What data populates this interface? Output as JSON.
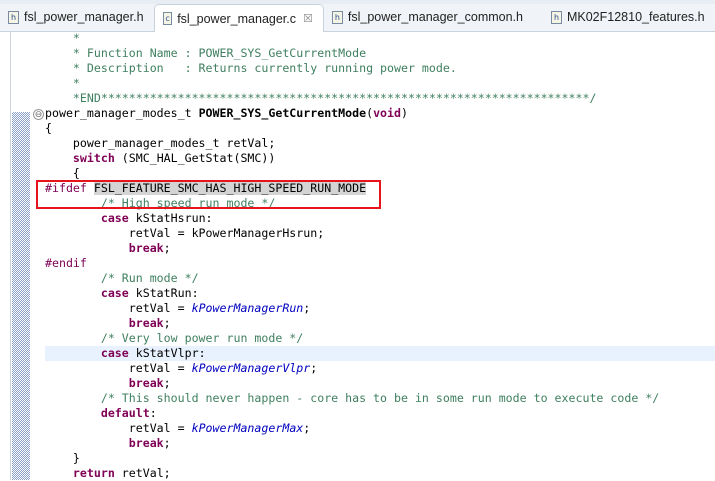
{
  "tabs": [
    {
      "label": "fsl_power_manager.h",
      "icon": "h-file-icon",
      "glyph": "h"
    },
    {
      "label": "fsl_power_manager.c",
      "icon": "c-file-icon",
      "glyph": "c",
      "active": true,
      "close": "☒"
    },
    {
      "label": "fsl_power_manager_common.h",
      "icon": "h-file-icon",
      "glyph": "h"
    },
    {
      "label": "MK02F12810_features.h",
      "icon": "h-file-icon",
      "glyph": "h"
    }
  ],
  "code": [
    [
      [
        "c",
        "    *"
      ]
    ],
    [
      [
        "c",
        "    * Function Name : POWER_SYS_GetCurrentMode"
      ]
    ],
    [
      [
        "c",
        "    * Description   : Returns currently running power mode."
      ]
    ],
    [
      [
        "c",
        "    *"
      ]
    ],
    [
      [
        "c",
        "    *END**********************************************************************/"
      ]
    ],
    [
      [
        "",
        "power_manager_modes_t "
      ],
      [
        "b",
        "POWER_SYS_GetCurrentMode"
      ],
      [
        "",
        "("
      ],
      [
        "k",
        "void"
      ],
      [
        "",
        ")"
      ]
    ],
    [
      [
        "",
        "{"
      ]
    ],
    [
      [
        "",
        "    power_manager_modes_t retVal;"
      ]
    ],
    [
      [
        "",
        "    "
      ],
      [
        "k",
        "switch"
      ],
      [
        "",
        " (SMC_HAL_GetStat(SMC))"
      ]
    ],
    [
      [
        "",
        "    {"
      ]
    ],
    [
      [
        "p",
        "#ifdef"
      ],
      [
        "",
        " "
      ],
      [
        "mark",
        "FSL_FEATURE_SMC_HAS_HIGH_SPEED_RUN_MODE"
      ]
    ],
    [
      [
        "c",
        "        /* High speed run mode */"
      ]
    ],
    [
      [
        "",
        "        "
      ],
      [
        "k",
        "case"
      ],
      [
        "",
        " kStatHsrun:"
      ]
    ],
    [
      [
        "",
        "            retVal = kPowerManagerHsrun;"
      ]
    ],
    [
      [
        "",
        "            "
      ],
      [
        "k",
        "break"
      ],
      [
        "",
        ";"
      ]
    ],
    [
      [
        "p",
        "#endif"
      ]
    ],
    [
      [
        "c",
        "        /* Run mode */"
      ]
    ],
    [
      [
        "",
        "        "
      ],
      [
        "k",
        "case"
      ],
      [
        "",
        " kStatRun:"
      ]
    ],
    [
      [
        "",
        "            retVal = "
      ],
      [
        "i",
        "kPowerManagerRun"
      ],
      [
        "",
        ";"
      ]
    ],
    [
      [
        "",
        "            "
      ],
      [
        "k",
        "break"
      ],
      [
        "",
        ";"
      ]
    ],
    [
      [
        "c",
        "        /* Very low power run mode */"
      ]
    ],
    [
      [
        "",
        "        "
      ],
      [
        "k",
        "case"
      ],
      [
        "",
        " kStatVlpr:"
      ]
    ],
    [
      [
        "",
        "            retVal = "
      ],
      [
        "i",
        "kPowerManagerVlpr"
      ],
      [
        "",
        ";"
      ]
    ],
    [
      [
        "",
        "            "
      ],
      [
        "k",
        "break"
      ],
      [
        "",
        ";"
      ]
    ],
    [
      [
        "c",
        "        /* This should never happen - core has to be in some run mode to execute code */"
      ]
    ],
    [
      [
        "",
        "        "
      ],
      [
        "k",
        "default"
      ],
      [
        "",
        ":"
      ]
    ],
    [
      [
        "",
        "            retVal = "
      ],
      [
        "i",
        "kPowerManagerMax"
      ],
      [
        "",
        ";"
      ]
    ],
    [
      [
        "",
        "            "
      ],
      [
        "k",
        "break"
      ],
      [
        "",
        ";"
      ]
    ],
    [
      [
        "",
        "    }"
      ]
    ],
    [
      [
        "",
        "    "
      ],
      [
        "k",
        "return"
      ],
      [
        "",
        " retVal;"
      ]
    ]
  ],
  "highlighted_line": 21,
  "fold_line": 5,
  "fold_glyph": "⊖",
  "colors": {
    "keyword": "#7f0055",
    "comment": "#3f7f5f",
    "enum": "#0000c0",
    "highlight_box": "#e8141b"
  }
}
